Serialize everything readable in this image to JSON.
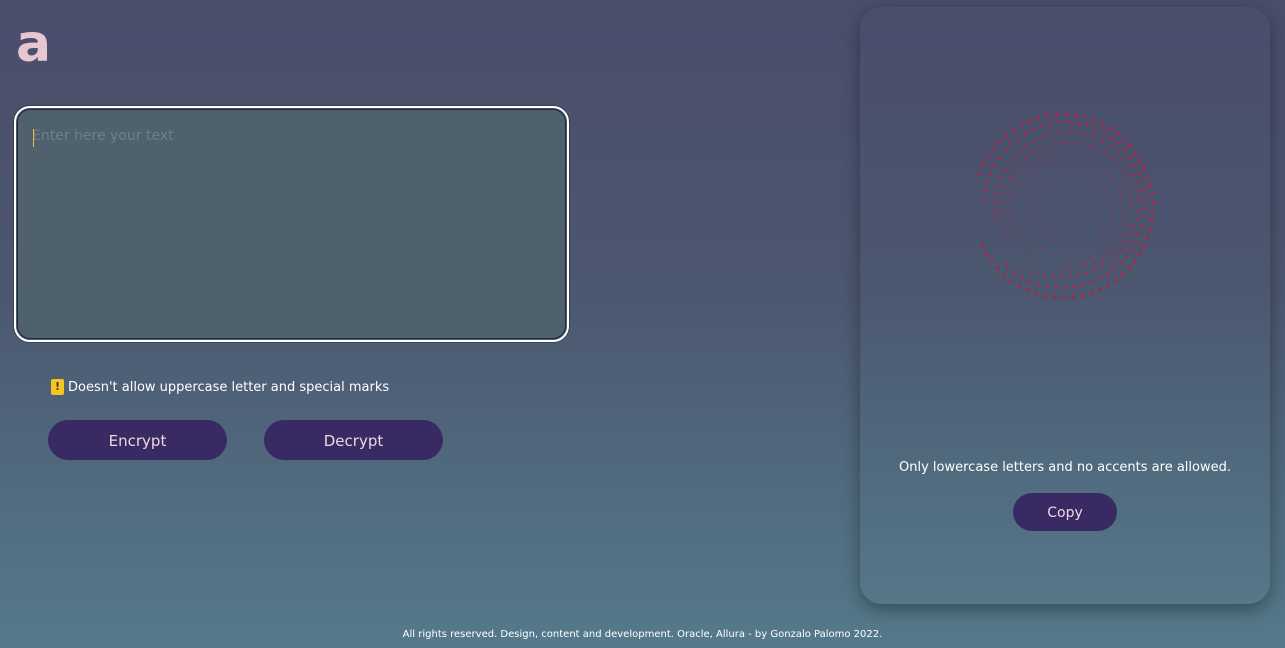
{
  "logo": {
    "text": "a"
  },
  "input": {
    "placeholder": "Enter here your text",
    "value": ""
  },
  "hint": {
    "icon": "exclamation-warning-icon",
    "text": "Doesn't allow uppercase letter and special marks"
  },
  "buttons": {
    "encrypt": "Encrypt",
    "decrypt": "Decrypt",
    "copy": "Copy"
  },
  "output_panel": {
    "illustration": "spiral-loader-icon",
    "message": "Only lowercase letters and no accents are allowed."
  },
  "footer": {
    "text": "All rights reserved. Design, content and development. Oracle, Allura - by Gonzalo Palomo 2022."
  },
  "colors": {
    "logo": "#e8c5d2",
    "button_bg": "#3a2a64",
    "button_text": "#f0d6df",
    "spiral": "#c21b3a",
    "warning": "#f3c622"
  }
}
